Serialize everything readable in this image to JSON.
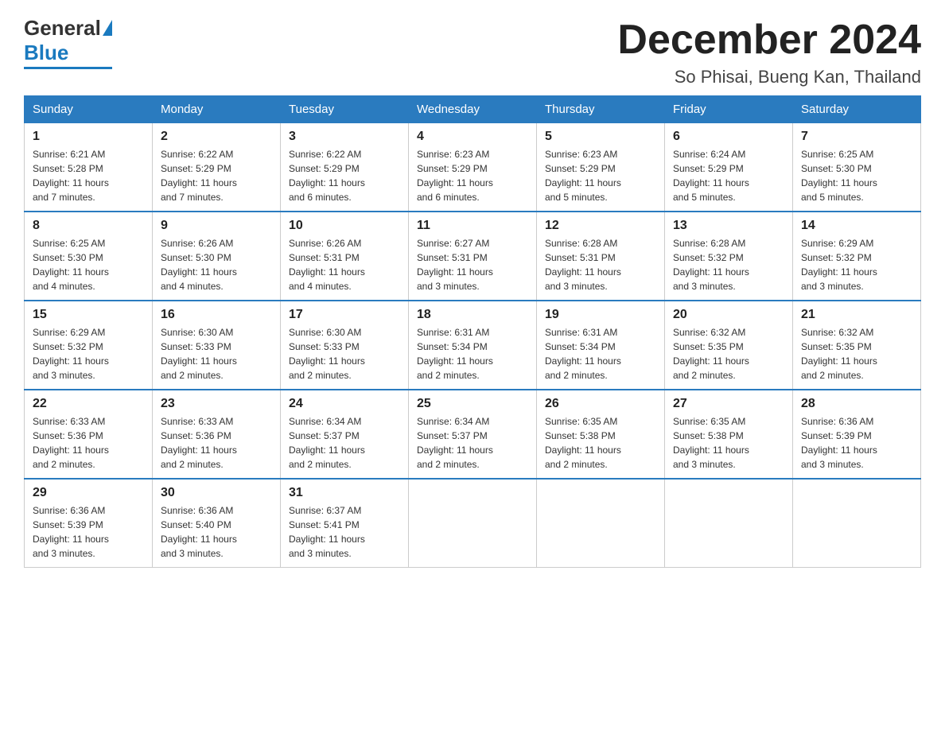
{
  "logo": {
    "general": "General",
    "blue": "Blue"
  },
  "header": {
    "month": "December 2024",
    "location": "So Phisai, Bueng Kan, Thailand"
  },
  "weekdays": [
    "Sunday",
    "Monday",
    "Tuesday",
    "Wednesday",
    "Thursday",
    "Friday",
    "Saturday"
  ],
  "weeks": [
    [
      {
        "day": "1",
        "sunrise": "6:21 AM",
        "sunset": "5:28 PM",
        "daylight": "11 hours and 7 minutes."
      },
      {
        "day": "2",
        "sunrise": "6:22 AM",
        "sunset": "5:29 PM",
        "daylight": "11 hours and 7 minutes."
      },
      {
        "day": "3",
        "sunrise": "6:22 AM",
        "sunset": "5:29 PM",
        "daylight": "11 hours and 6 minutes."
      },
      {
        "day": "4",
        "sunrise": "6:23 AM",
        "sunset": "5:29 PM",
        "daylight": "11 hours and 6 minutes."
      },
      {
        "day": "5",
        "sunrise": "6:23 AM",
        "sunset": "5:29 PM",
        "daylight": "11 hours and 5 minutes."
      },
      {
        "day": "6",
        "sunrise": "6:24 AM",
        "sunset": "5:29 PM",
        "daylight": "11 hours and 5 minutes."
      },
      {
        "day": "7",
        "sunrise": "6:25 AM",
        "sunset": "5:30 PM",
        "daylight": "11 hours and 5 minutes."
      }
    ],
    [
      {
        "day": "8",
        "sunrise": "6:25 AM",
        "sunset": "5:30 PM",
        "daylight": "11 hours and 4 minutes."
      },
      {
        "day": "9",
        "sunrise": "6:26 AM",
        "sunset": "5:30 PM",
        "daylight": "11 hours and 4 minutes."
      },
      {
        "day": "10",
        "sunrise": "6:26 AM",
        "sunset": "5:31 PM",
        "daylight": "11 hours and 4 minutes."
      },
      {
        "day": "11",
        "sunrise": "6:27 AM",
        "sunset": "5:31 PM",
        "daylight": "11 hours and 3 minutes."
      },
      {
        "day": "12",
        "sunrise": "6:28 AM",
        "sunset": "5:31 PM",
        "daylight": "11 hours and 3 minutes."
      },
      {
        "day": "13",
        "sunrise": "6:28 AM",
        "sunset": "5:32 PM",
        "daylight": "11 hours and 3 minutes."
      },
      {
        "day": "14",
        "sunrise": "6:29 AM",
        "sunset": "5:32 PM",
        "daylight": "11 hours and 3 minutes."
      }
    ],
    [
      {
        "day": "15",
        "sunrise": "6:29 AM",
        "sunset": "5:32 PM",
        "daylight": "11 hours and 3 minutes."
      },
      {
        "day": "16",
        "sunrise": "6:30 AM",
        "sunset": "5:33 PM",
        "daylight": "11 hours and 2 minutes."
      },
      {
        "day": "17",
        "sunrise": "6:30 AM",
        "sunset": "5:33 PM",
        "daylight": "11 hours and 2 minutes."
      },
      {
        "day": "18",
        "sunrise": "6:31 AM",
        "sunset": "5:34 PM",
        "daylight": "11 hours and 2 minutes."
      },
      {
        "day": "19",
        "sunrise": "6:31 AM",
        "sunset": "5:34 PM",
        "daylight": "11 hours and 2 minutes."
      },
      {
        "day": "20",
        "sunrise": "6:32 AM",
        "sunset": "5:35 PM",
        "daylight": "11 hours and 2 minutes."
      },
      {
        "day": "21",
        "sunrise": "6:32 AM",
        "sunset": "5:35 PM",
        "daylight": "11 hours and 2 minutes."
      }
    ],
    [
      {
        "day": "22",
        "sunrise": "6:33 AM",
        "sunset": "5:36 PM",
        "daylight": "11 hours and 2 minutes."
      },
      {
        "day": "23",
        "sunrise": "6:33 AM",
        "sunset": "5:36 PM",
        "daylight": "11 hours and 2 minutes."
      },
      {
        "day": "24",
        "sunrise": "6:34 AM",
        "sunset": "5:37 PM",
        "daylight": "11 hours and 2 minutes."
      },
      {
        "day": "25",
        "sunrise": "6:34 AM",
        "sunset": "5:37 PM",
        "daylight": "11 hours and 2 minutes."
      },
      {
        "day": "26",
        "sunrise": "6:35 AM",
        "sunset": "5:38 PM",
        "daylight": "11 hours and 2 minutes."
      },
      {
        "day": "27",
        "sunrise": "6:35 AM",
        "sunset": "5:38 PM",
        "daylight": "11 hours and 3 minutes."
      },
      {
        "day": "28",
        "sunrise": "6:36 AM",
        "sunset": "5:39 PM",
        "daylight": "11 hours and 3 minutes."
      }
    ],
    [
      {
        "day": "29",
        "sunrise": "6:36 AM",
        "sunset": "5:39 PM",
        "daylight": "11 hours and 3 minutes."
      },
      {
        "day": "30",
        "sunrise": "6:36 AM",
        "sunset": "5:40 PM",
        "daylight": "11 hours and 3 minutes."
      },
      {
        "day": "31",
        "sunrise": "6:37 AM",
        "sunset": "5:41 PM",
        "daylight": "11 hours and 3 minutes."
      },
      null,
      null,
      null,
      null
    ]
  ]
}
